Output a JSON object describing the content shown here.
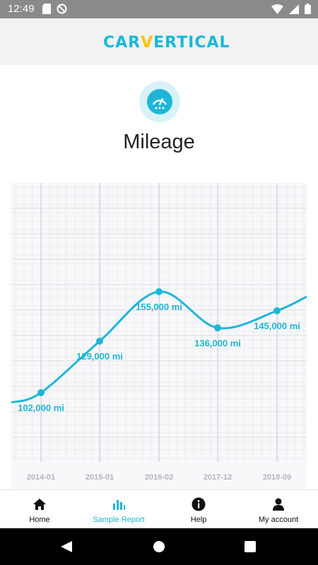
{
  "status_bar": {
    "time": "12:49",
    "icons": [
      "sd-card-icon",
      "no-location-icon",
      "wifi-icon",
      "signal-icon",
      "battery-icon"
    ]
  },
  "header": {
    "logo_part1": "CAR",
    "logo_part2": "V",
    "logo_part3": "ERTICAL",
    "brand_colors": {
      "primary": "#19b8d6",
      "accent": "#f5c400"
    }
  },
  "section": {
    "icon": "speedometer-icon",
    "title": "Mileage"
  },
  "chart_data": {
    "type": "line",
    "x": [
      "2014-01",
      "2015-01",
      "2016-02",
      "2017-12",
      "2018-09"
    ],
    "values": [
      102000,
      129000,
      155000,
      136000,
      145000
    ],
    "point_labels": [
      "102,000 mi",
      "129,000 mi",
      "155,000 mi",
      "136,000 mi",
      "145,000 mi"
    ],
    "line_color": "#1eb6d7",
    "grid": true
  },
  "bottom_nav": {
    "items": [
      {
        "label": "Home",
        "icon": "home-icon",
        "active": false
      },
      {
        "label": "Sample Report",
        "icon": "bar-chart-icon",
        "active": true
      },
      {
        "label": "Help",
        "icon": "info-icon",
        "active": false
      },
      {
        "label": "My account",
        "icon": "person-icon",
        "active": false
      }
    ],
    "active_color": "#1eb6d7"
  },
  "system_nav": {
    "buttons": [
      "back-icon",
      "home-circle-icon",
      "recents-icon"
    ]
  }
}
